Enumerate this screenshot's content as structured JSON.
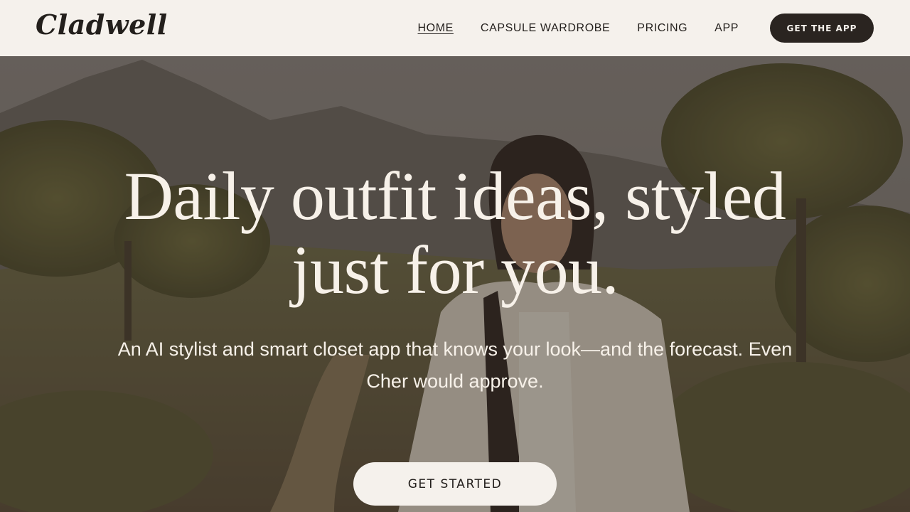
{
  "header": {
    "logo": "Cladwell",
    "nav": [
      {
        "label": "HOME",
        "active": true
      },
      {
        "label": "CAPSULE WARDROBE",
        "active": false
      },
      {
        "label": "PRICING",
        "active": false
      },
      {
        "label": "APP",
        "active": false
      }
    ],
    "cta_label": "GET THE APP"
  },
  "hero": {
    "headline_line1": "Daily outfit ideas, styled",
    "headline_line2": "just for you.",
    "subhead": "An AI stylist and smart closet app that knows your look—and the forecast. Even Cher would approve.",
    "cta_label": "GET STARTED"
  },
  "colors": {
    "background": "#f5f1ec",
    "dark": "#231f1c",
    "button_dark": "#2a2420"
  }
}
